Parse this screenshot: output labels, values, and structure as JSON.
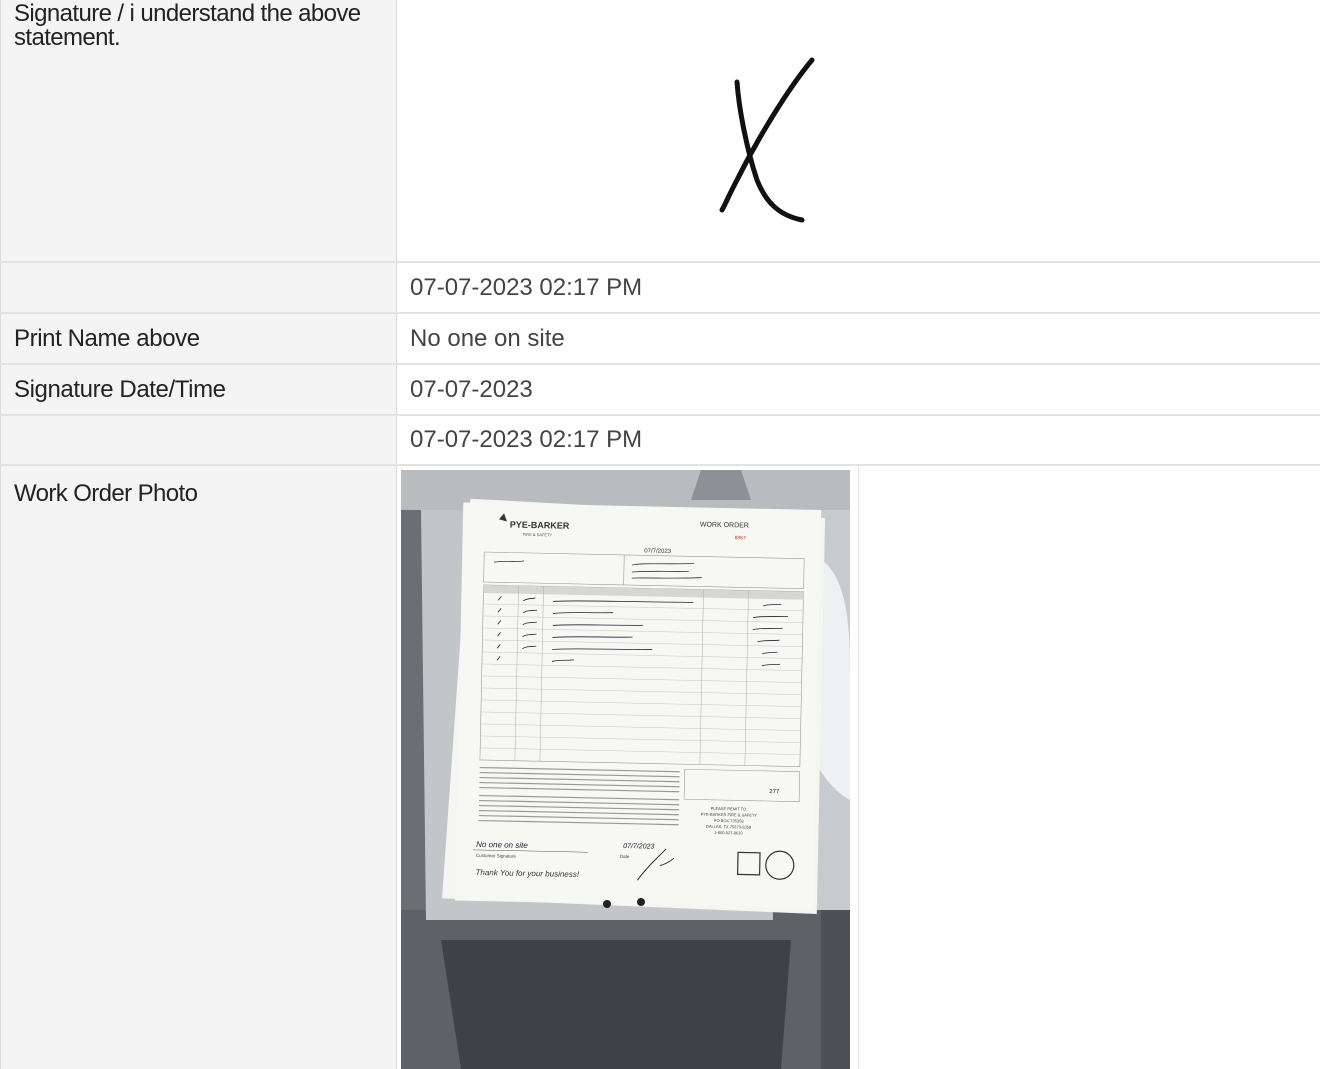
{
  "rows": [
    {
      "label": "Signature / i understand the above statement.",
      "value": ""
    },
    {
      "label": "",
      "value": "07-07-2023 02:17 PM"
    },
    {
      "label": "Print Name above",
      "value": "No one on site"
    },
    {
      "label": "Signature Date/Time",
      "value": "07-07-2023"
    },
    {
      "label": "",
      "value": "07-07-2023 02:17 PM"
    },
    {
      "label": "Work Order Photo",
      "value": ""
    }
  ],
  "signature": {
    "mark": "X"
  },
  "photo": {
    "company": "PYE-BARKER",
    "company_sub": "FIRE & SAFETY",
    "doc_title": "WORK ORDER",
    "order_no": "8967",
    "date": "07/7/2023",
    "customer_name": "No one on site",
    "customer_signature_label": "Customer Signature",
    "date_label": "Date",
    "signed_date": "07/7/2023",
    "thank_you": "Thank You for your business!",
    "total": "277",
    "remit": [
      "PLEASE REMIT TO:",
      "PYE-BARKER FIRE & SAFETY",
      "PO BOX 735358",
      "DALLAS, TX 75373-5358",
      "1-800-027-8610"
    ]
  }
}
